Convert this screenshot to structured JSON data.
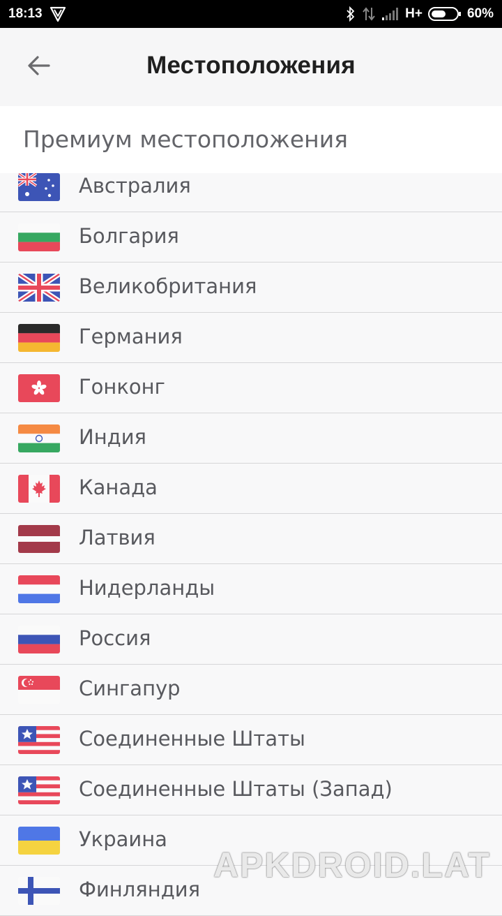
{
  "status_bar": {
    "time": "18:13",
    "network": "H+",
    "battery": "60%",
    "battery_level": 0.6,
    "icons": [
      "vpn-shield-icon",
      "bluetooth-icon",
      "data-transfer-icon",
      "signal-icon",
      "battery-icon"
    ]
  },
  "header": {
    "title": "Местоположения",
    "back_icon": "arrow-left-icon"
  },
  "section": {
    "title": "Премиум местоположения"
  },
  "locations": [
    {
      "name": "Австралия",
      "flag": "au"
    },
    {
      "name": "Болгария",
      "flag": "bg"
    },
    {
      "name": "Великобритания",
      "flag": "gb"
    },
    {
      "name": "Германия",
      "flag": "de"
    },
    {
      "name": "Гонконг",
      "flag": "hk"
    },
    {
      "name": "Индия",
      "flag": "in"
    },
    {
      "name": "Канада",
      "flag": "ca"
    },
    {
      "name": "Латвия",
      "flag": "lv"
    },
    {
      "name": "Нидерланды",
      "flag": "nl"
    },
    {
      "name": "Россия",
      "flag": "ru"
    },
    {
      "name": "Сингапур",
      "flag": "sg"
    },
    {
      "name": "Соединенные Штаты",
      "flag": "us"
    },
    {
      "name": "Соединенные Штаты (Запад)",
      "flag": "us"
    },
    {
      "name": "Украина",
      "flag": "ua"
    },
    {
      "name": "Финляндия",
      "flag": "fi"
    }
  ],
  "watermark": "APKDROID.LAT",
  "colors": {
    "accent_red": "#e8485a",
    "text_primary": "#1f1f1f",
    "text_secondary": "#58595e"
  }
}
